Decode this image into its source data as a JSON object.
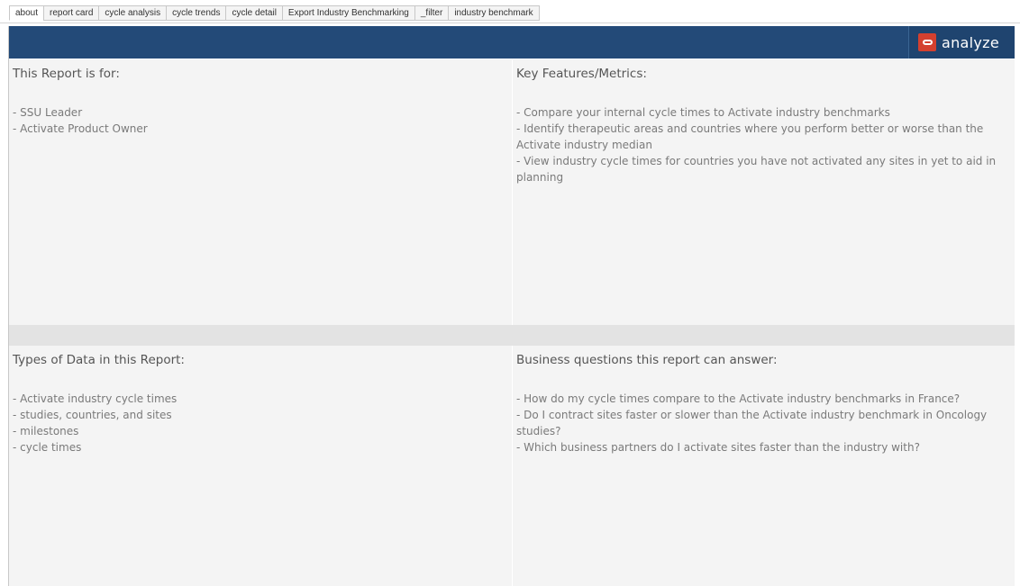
{
  "tabs": [
    {
      "label": "about",
      "active": true
    },
    {
      "label": "report card",
      "active": false
    },
    {
      "label": "cycle analysis",
      "active": false
    },
    {
      "label": "cycle trends",
      "active": false
    },
    {
      "label": "cycle detail",
      "active": false
    },
    {
      "label": "Export Industry Benchmarking",
      "active": false
    },
    {
      "label": "_filter",
      "active": false
    },
    {
      "label": "industry benchmark",
      "active": false
    }
  ],
  "brand": {
    "name": "analyze",
    "icon": "oracle-ring-icon",
    "accent": "#d4402f",
    "header_color": "#234a78"
  },
  "panels": {
    "audience": {
      "title": "This Report is for:",
      "body": "- SSU Leader\n- Activate Product Owner"
    },
    "features": {
      "title": "Key Features/Metrics:",
      "body": "- Compare your internal cycle times to Activate industry benchmarks\n- Identify therapeutic areas and countries where you perform better or worse than the Activate industry median\n- View industry cycle times for countries you have not activated any sites in yet to aid in planning"
    },
    "data_types": {
      "title": "Types of Data in this Report:",
      "body": "- Activate industry cycle times\n- studies, countries, and sites\n- milestones\n- cycle times"
    },
    "questions": {
      "title": "Business questions this report can answer:",
      "body": "- How do my cycle times compare to the Activate industry benchmarks in France?\n- Do I contract sites faster or slower than the Activate industry benchmark in Oncology studies?\n- Which business partners do I activate sites faster than the industry with?"
    }
  }
}
